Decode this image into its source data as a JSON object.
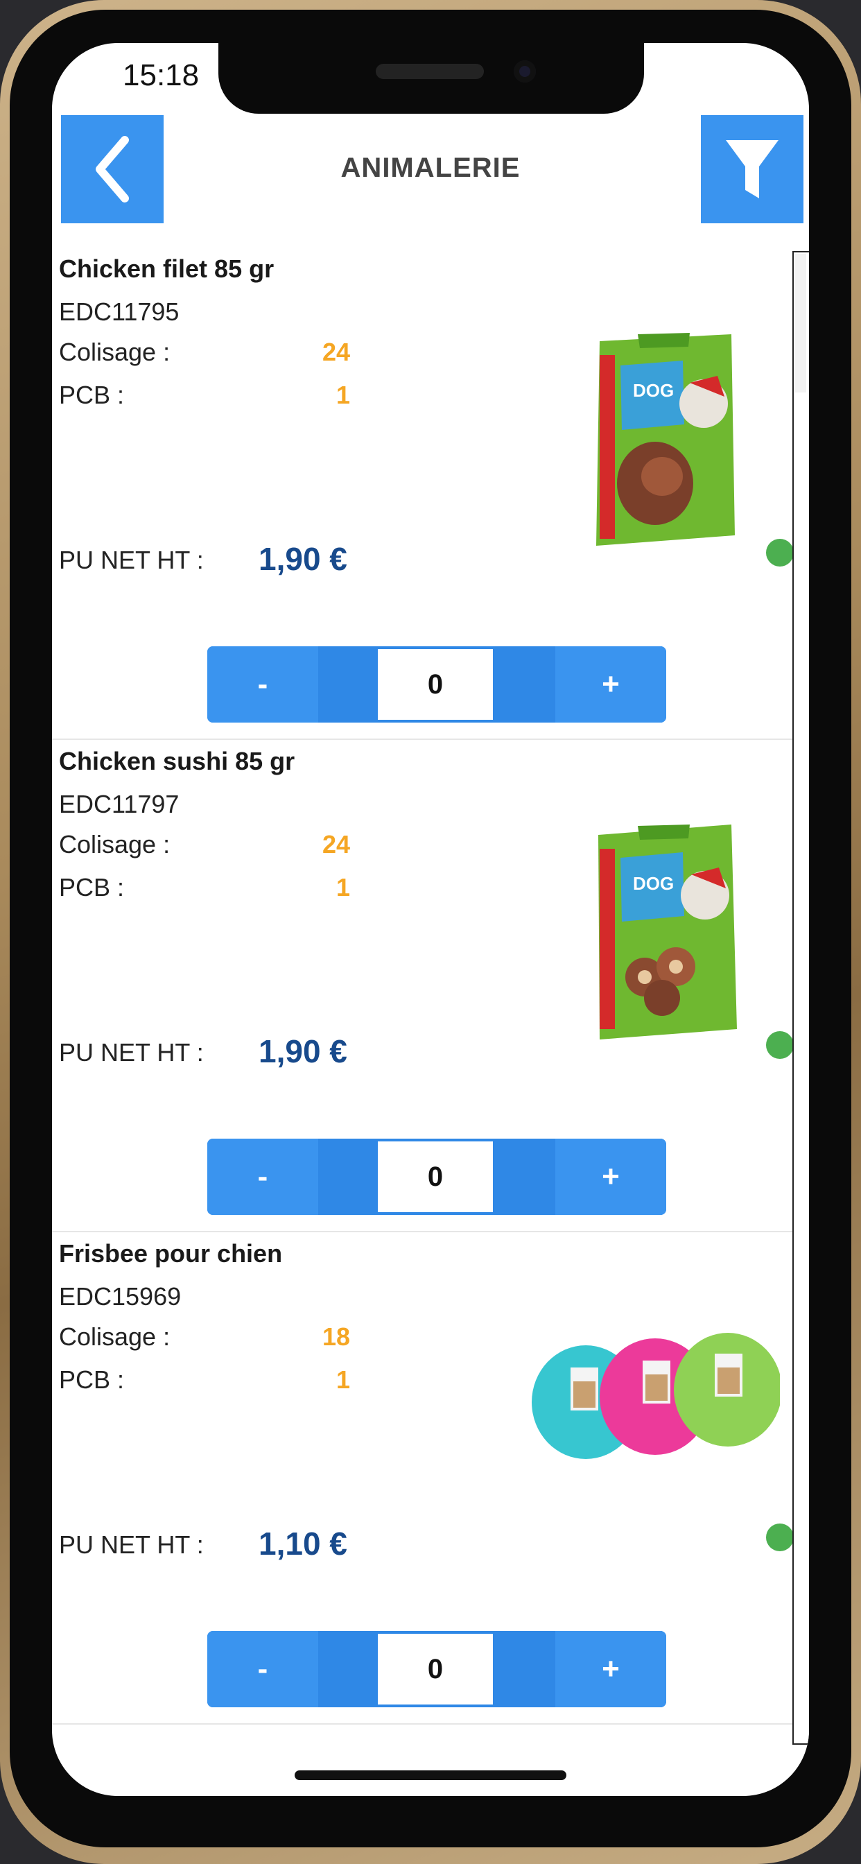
{
  "status": {
    "time": "15:18"
  },
  "header": {
    "title": "ANIMALERIE",
    "back_icon": "chevron-left-icon",
    "filter_icon": "funnel-icon"
  },
  "labels": {
    "colisage": "Colisage :",
    "pcb": "PCB :",
    "price": "PU NET HT :"
  },
  "stepper": {
    "minus": "-",
    "plus": "+"
  },
  "colors": {
    "accent": "#3a94ef",
    "price": "#184a8c",
    "highlight": "#f5a623",
    "status_dot": "#4caf50"
  },
  "products": [
    {
      "name": "Chicken filet 85 gr",
      "ref": "EDC11795",
      "colisage": "24",
      "pcb": "1",
      "price": "1,90 €",
      "qty": "0",
      "image": "dog-treat-bag-icon"
    },
    {
      "name": "Chicken sushi 85 gr",
      "ref": "EDC11797",
      "colisage": "24",
      "pcb": "1",
      "price": "1,90 €",
      "qty": "0",
      "image": "dog-treat-bag-icon"
    },
    {
      "name": "Frisbee pour chien",
      "ref": "EDC15969",
      "colisage": "18",
      "pcb": "1",
      "price": "1,10 €",
      "qty": "0",
      "image": "frisbee-set-icon"
    }
  ]
}
